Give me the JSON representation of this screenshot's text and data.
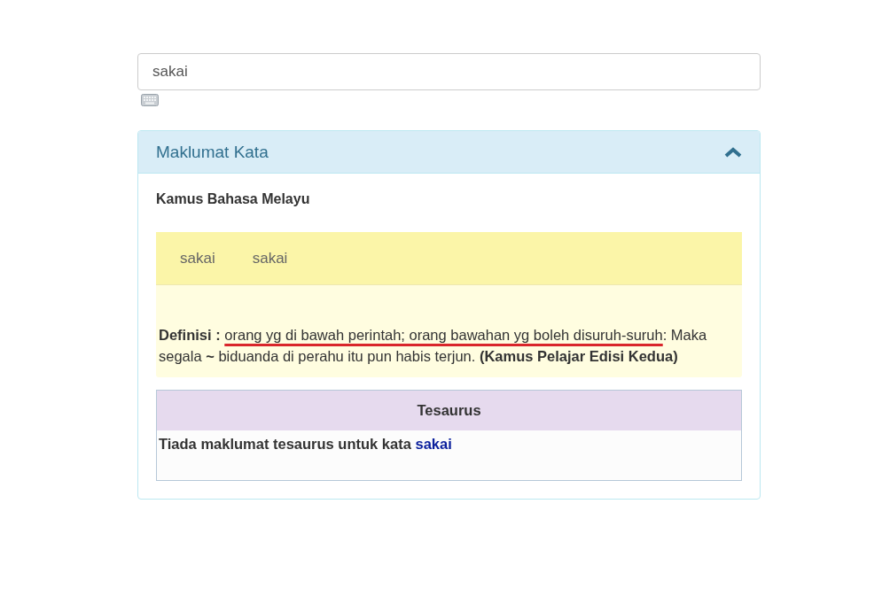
{
  "search": {
    "value": "sakai"
  },
  "panel": {
    "title": "Maklumat Kata",
    "expanded": true,
    "source": "Kamus Bahasa Melayu",
    "entry": {
      "words": [
        "sakai",
        "sakai"
      ],
      "definition": {
        "label": "Definisi :",
        "marked": "orang yg di bawah perintah; orang bawahan yg boleh disuruh-suruh",
        "rest": ": Maka segala **~** biduanda di perahu itu pun habis terjun. **(Kamus Pelajar Edisi Kedua)**"
      }
    },
    "thesaurus": {
      "title": "Tesaurus",
      "message": "Tiada maklumat tesaurus untuk kata",
      "link": "sakai"
    }
  }
}
